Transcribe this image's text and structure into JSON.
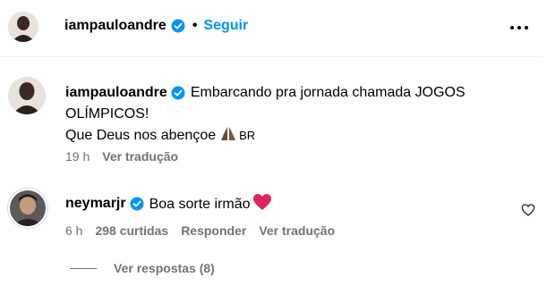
{
  "header": {
    "username": "iampauloandre",
    "separator": "•",
    "follow_label": "Seguir",
    "more_icon": "more-horizontal-icon"
  },
  "comments": [
    {
      "username": "iampauloandre",
      "text_line1": "Embarcando pra jornada chamada JOGOS",
      "text_line2": "OLÍMPICOS!",
      "text_line3": "Que Deus nos abençoe",
      "flag_text": "BR",
      "emoji": "praying-hands",
      "time": "19 h",
      "translate": "Ver tradução"
    },
    {
      "username": "neymarjr",
      "text": "Boa sorte irmão",
      "emoji": "red-heart",
      "time": "6 h",
      "likes": "298 curtidas",
      "reply": "Responder",
      "translate": "Ver tradução"
    }
  ],
  "replies": {
    "label": "Ver respostas (8)"
  },
  "colors": {
    "accent": "#0095f6",
    "meta": "#737373",
    "verified": "#0095f6",
    "heart": "#e0245e"
  }
}
